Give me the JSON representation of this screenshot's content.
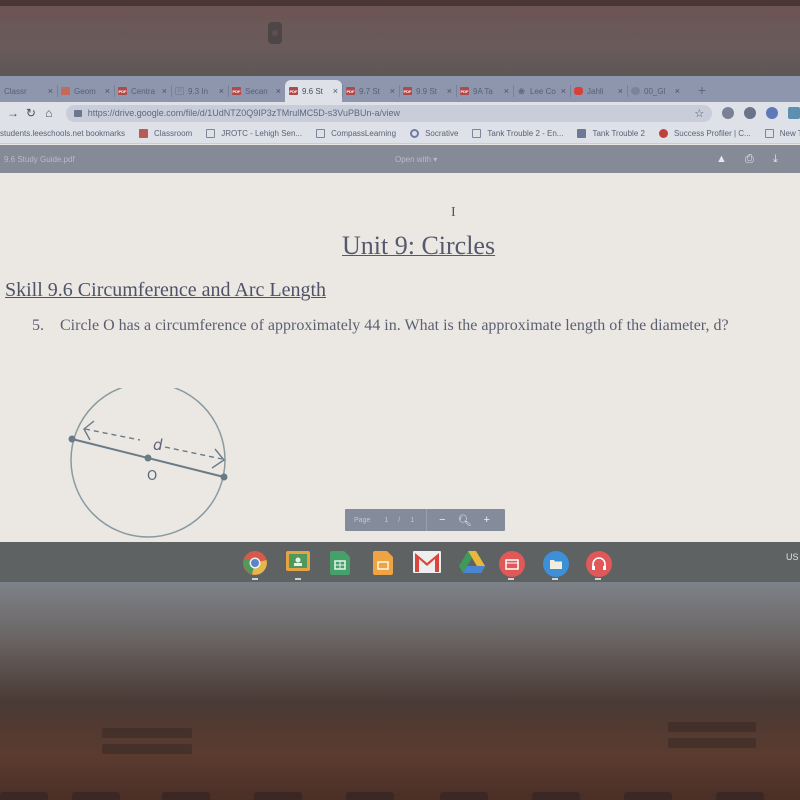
{
  "browser": {
    "tabs": [
      {
        "label": "Classr",
        "favicon": "none",
        "active": false
      },
      {
        "label": "Geom",
        "favicon": "google-classroom-icon",
        "active": false
      },
      {
        "label": "Centra",
        "favicon": "pdf-icon",
        "active": false
      },
      {
        "label": "9.3 In",
        "favicon": "docs-icon",
        "active": false
      },
      {
        "label": "Secan",
        "favicon": "pdf-icon",
        "active": false
      },
      {
        "label": "9.6 St",
        "favicon": "pdf-icon",
        "active": true
      },
      {
        "label": "9.7 St",
        "favicon": "pdf-icon",
        "active": false
      },
      {
        "label": "9.9 St",
        "favicon": "pdf-icon",
        "active": false
      },
      {
        "label": "9A Ta",
        "favicon": "pdf-icon",
        "active": false
      },
      {
        "label": "Lee Co",
        "favicon": "lee-schools-icon",
        "active": false
      },
      {
        "label": "Jahli",
        "favicon": "youtube-icon",
        "active": false
      },
      {
        "label": "00_Gl",
        "favicon": "chrome-icon",
        "active": false
      }
    ],
    "close_glyph": "×",
    "new_tab_glyph": "+",
    "url": "https://drive.google.com/file/d/1UdNTZ0Q9IP3zTMrulMC5D-s3VuPBUn-a/view",
    "bookmarks": [
      {
        "label": "students.leeschools.net bookmarks",
        "icon": "none"
      },
      {
        "label": "Classroom",
        "icon": "classroom-icon"
      },
      {
        "label": "JROTC - Lehigh Sen...",
        "icon": "page-icon"
      },
      {
        "label": "CompassLearning",
        "icon": "page-icon"
      },
      {
        "label": "Socrative",
        "icon": "socrative-icon"
      },
      {
        "label": "Tank Trouble 2 - En...",
        "icon": "page-icon"
      },
      {
        "label": "Tank Trouble 2",
        "icon": "tank-icon"
      },
      {
        "label": "Success Profiler | C...",
        "icon": "success-icon"
      },
      {
        "label": "New Tab",
        "icon": "page-icon"
      }
    ]
  },
  "pdf_viewer": {
    "filename": "9.6 Study Guide.pdf",
    "open_with": "Open with",
    "page_label": "Page",
    "current_page": "1",
    "page_separator": "/",
    "total_pages": "1",
    "zoom_out": "−",
    "zoom_in": "+"
  },
  "document": {
    "title": "Unit 9: Circles",
    "skill": "Skill 9.6 Circumference and Arc Length",
    "question_number": "5.",
    "question_text": "Circle O has a circumference of approximately 44 in. What is the approximate length of the diameter, d?",
    "diagram": {
      "diameter_label": "d",
      "center_label": "O"
    }
  },
  "shelf": {
    "apps": [
      "chrome",
      "google-classroom",
      "google-sheets",
      "google-slides",
      "gmail",
      "google-drive",
      "video-player",
      "files",
      "audio-player"
    ],
    "status_text": "US"
  }
}
